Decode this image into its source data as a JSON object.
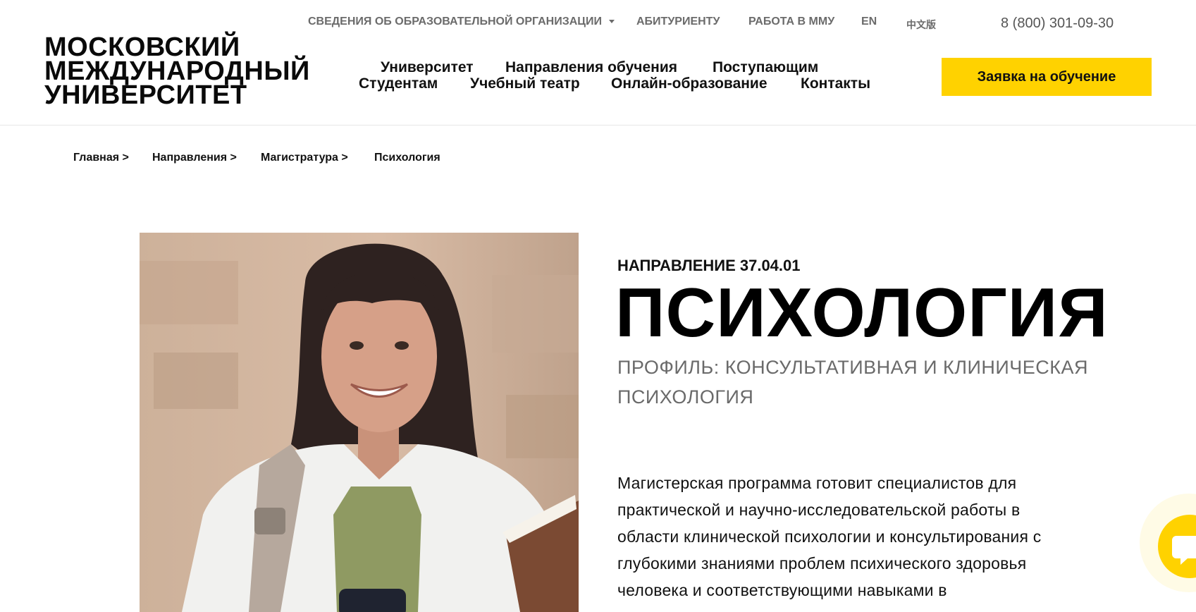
{
  "header": {
    "logo_lines": [
      "МОСКОВСКИЙ",
      "МЕЖДУНАРОДНЫЙ",
      "УНИВЕРСИТЕТ"
    ],
    "top_nav": {
      "org_info": "СВЕДЕНИЯ ОБ ОБРАЗОВАТЕЛЬНОЙ ОРГАНИЗАЦИИ",
      "applicant": "АБИТУРИЕНТУ",
      "jobs": "РАБОТА В ММУ",
      "lang_en": "EN",
      "lang_zh": "中文版"
    },
    "phone": "8 (800) 301-09-30",
    "main_nav": {
      "university": "Университет",
      "directions": "Направления обучения",
      "applicants": "Поступающим",
      "students": "Студентам",
      "theatre": "Учебный театр",
      "online": "Онлайн-образование",
      "contacts": "Контакты"
    },
    "cta": "Заявка на обучение"
  },
  "breadcrumbs": [
    "Главная >",
    "Направления >",
    "Магистратура >",
    "Психология"
  ],
  "program": {
    "code_label": "НАПРАВЛЕНИЕ 37.04.01",
    "title": "ПСИХОЛОГИЯ",
    "profile": "ПРОФИЛЬ: КОНСУЛЬТАТИВНАЯ И КЛИНИЧЕСКАЯ ПСИХОЛОГИЯ",
    "description_lines": [
      "Магистерская программа готовит специалистов для",
      "практической и научно-исследовательской работы в",
      "области клинической психологии и консультирования с",
      "глубокими знаниями проблем психического здоровья",
      "человека и соответствующими навыками в"
    ]
  },
  "colors": {
    "accent": "#ffd200",
    "text": "#111111",
    "muted": "#6a6a6a"
  },
  "icons": {
    "dropdown": "chevron-down-icon",
    "chat": "chat-bubble-icon"
  }
}
